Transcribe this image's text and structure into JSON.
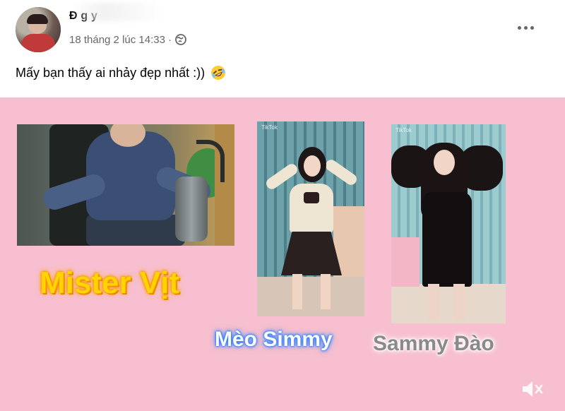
{
  "post": {
    "author_name": "Đ   g   y",
    "timestamp": "18 tháng 2 lúc 14:33",
    "separator": "·",
    "audience_icon": "globe-icon",
    "more_icon": "more-options-icon",
    "caption": "Mấy bạn thấy ai nhảy đẹp nhất :))",
    "caption_emoji": "rofl-emoji-icon"
  },
  "media": {
    "background_color": "#f7bfcf",
    "frames": [
      {
        "tag": ""
      },
      {
        "tag": "TikTok"
      },
      {
        "tag": "TikTok"
      }
    ],
    "labels": [
      {
        "text": "Mister Vịt",
        "color": "#ffd400"
      },
      {
        "text": "Mèo Simmy",
        "color": "#2a7bff"
      },
      {
        "text": "Sammy Đào",
        "color": "#8a8a8a"
      }
    ],
    "sound_icon": "muted-speaker-icon"
  }
}
